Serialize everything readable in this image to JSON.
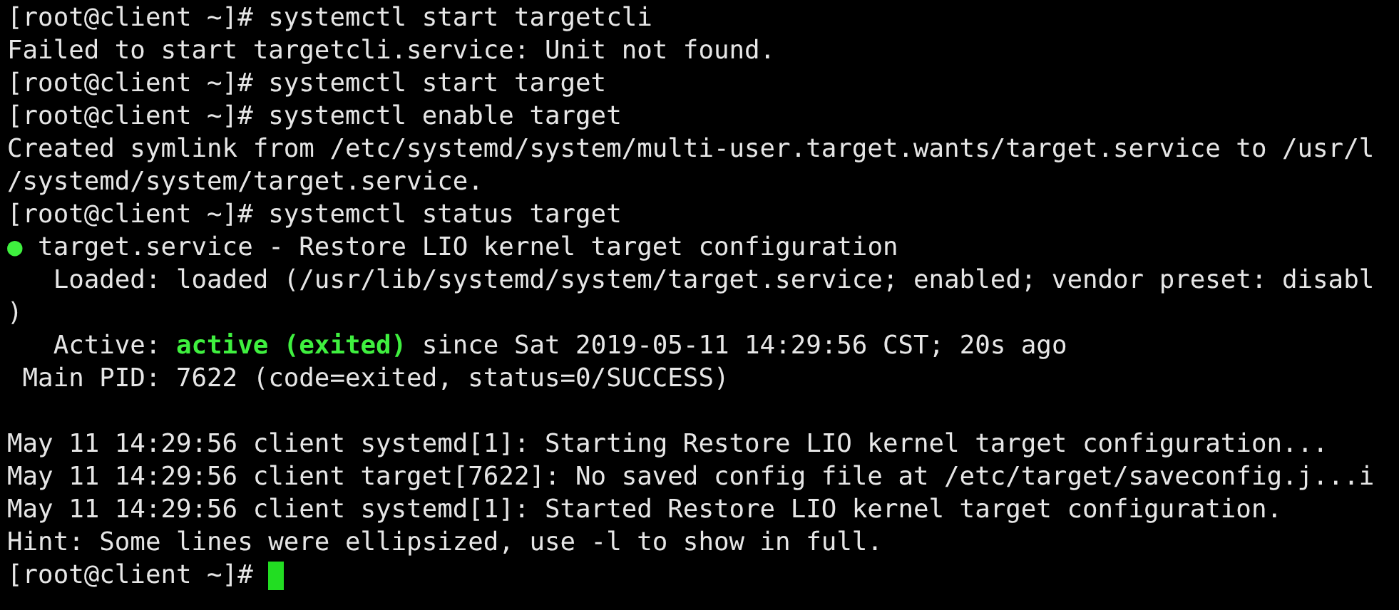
{
  "terminal": {
    "lines": [
      {
        "segments": [
          {
            "text": "[root@client ~]# systemctl start targetcli",
            "kind": "text"
          }
        ]
      },
      {
        "segments": [
          {
            "text": "Failed to start targetcli.service: Unit not found.",
            "kind": "text"
          }
        ]
      },
      {
        "segments": [
          {
            "text": "[root@client ~]# systemctl start target",
            "kind": "text"
          }
        ]
      },
      {
        "segments": [
          {
            "text": "[root@client ~]# systemctl enable target",
            "kind": "text"
          }
        ]
      },
      {
        "segments": [
          {
            "text": "Created symlink from /etc/systemd/system/multi-user.target.wants/target.service to /usr/l",
            "kind": "text"
          }
        ]
      },
      {
        "segments": [
          {
            "text": "/systemd/system/target.service.",
            "kind": "text"
          }
        ]
      },
      {
        "segments": [
          {
            "text": "[root@client ~]# systemctl status target",
            "kind": "text"
          }
        ]
      },
      {
        "segments": [
          {
            "text": "●",
            "kind": "status"
          },
          {
            "text": " target.service - Restore LIO kernel target configuration",
            "kind": "text"
          }
        ]
      },
      {
        "segments": [
          {
            "text": "   Loaded: loaded (/usr/lib/systemd/system/target.service; enabled; vendor preset: disabl",
            "kind": "text"
          }
        ]
      },
      {
        "segments": [
          {
            "text": ")",
            "kind": "text"
          }
        ]
      },
      {
        "segments": [
          {
            "text": "   Active: ",
            "kind": "text"
          },
          {
            "text": "active (exited)",
            "kind": "highlight"
          },
          {
            "text": " since Sat 2019-05-11 14:29:56 CST; 20s ago",
            "kind": "text"
          }
        ]
      },
      {
        "segments": [
          {
            "text": " Main PID: 7622 (code=exited, status=0/SUCCESS)",
            "kind": "text"
          }
        ]
      },
      {
        "gap_before": true,
        "segments": [
          {
            "text": "May 11 14:29:56 client systemd[1]: Starting Restore LIO kernel target configuration...",
            "kind": "text"
          }
        ]
      },
      {
        "segments": [
          {
            "text": "May 11 14:29:56 client target[7622]: No saved config file at /etc/target/saveconfig.j...i",
            "kind": "text"
          }
        ]
      },
      {
        "segments": [
          {
            "text": "May 11 14:29:56 client systemd[1]: Started Restore LIO kernel target configuration.",
            "kind": "text"
          }
        ]
      },
      {
        "segments": [
          {
            "text": "Hint: Some lines were ellipsized, use -l to show in full.",
            "kind": "text"
          }
        ]
      },
      {
        "cursor": true,
        "segments": [
          {
            "text": "[root@client ~]# ",
            "kind": "text"
          }
        ]
      }
    ]
  }
}
